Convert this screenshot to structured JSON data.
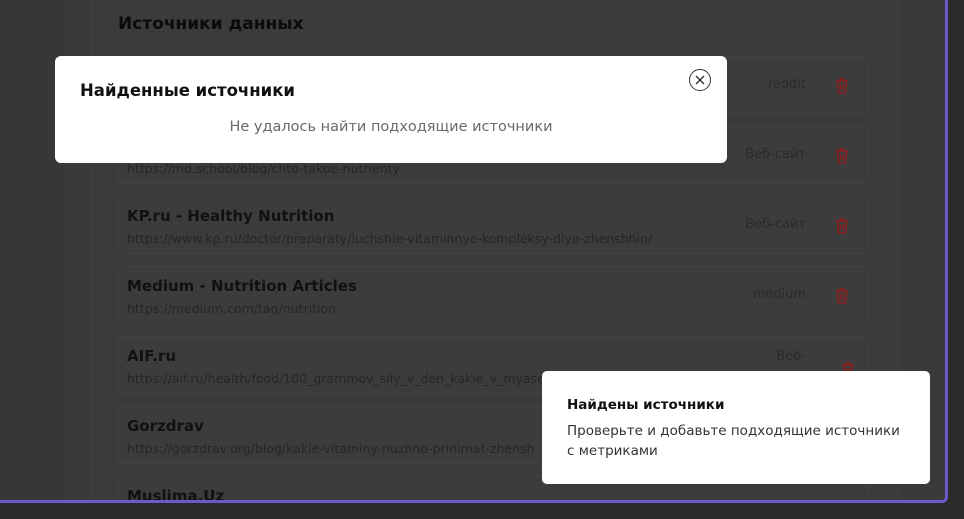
{
  "section": {
    "title": "Источники данных"
  },
  "rows": [
    {
      "title": "",
      "url": "",
      "type": "reddit"
    },
    {
      "title": "",
      "url": "https://md.school/blog/chto-takoe-nutrienty",
      "type": "Веб-сайт"
    },
    {
      "title": "KP.ru - Healthy Nutrition",
      "url": "https://www.kp.ru/doctor/preparaty/luchshie-vitaminnye-kompleksy-dlya-zhenshhin/",
      "type": "Веб-сайт"
    },
    {
      "title": "Medium - Nutrition Articles",
      "url": "https://medium.com/tag/nutrition",
      "type": "medium"
    },
    {
      "title": "AIF.ru",
      "url": "https://aif.ru/health/food/100_grammov_sily_v_den_kakie_v_myase_",
      "type": "Веб-"
    },
    {
      "title": "Gorzdrav",
      "url": "https://gorzdrav.org/blog/kakie-vitaminy-nuzhno-prinimat-zhensh",
      "type": ""
    },
    {
      "title": "Muslima.Uz",
      "url": "",
      "type": ""
    }
  ],
  "modal": {
    "title": "Найденные источники",
    "message": "Не удалось найти подходящие источники"
  },
  "toast": {
    "title": "Найдены источники",
    "text": "Проверьте и добавьте подходящие источники с метриками"
  },
  "colors": {
    "accent_border": "#6a5acd",
    "delete_icon": "#8b1e1e"
  },
  "icons": {
    "close": "close-icon",
    "delete": "trash-icon"
  }
}
